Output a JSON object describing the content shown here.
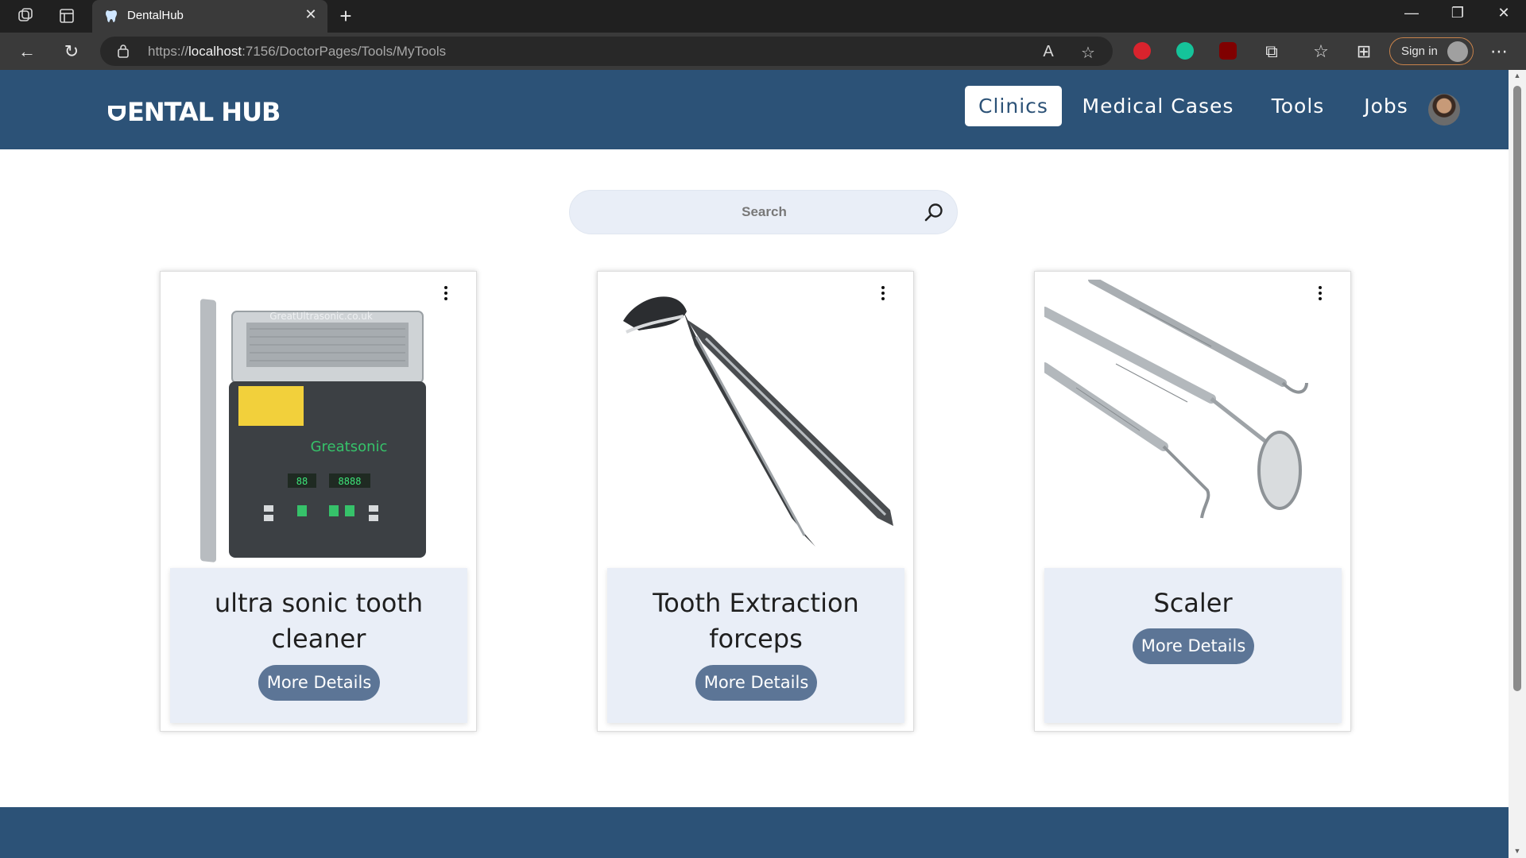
{
  "browser": {
    "tab_title": "DentalHub",
    "url_prefix": "https://",
    "url_host": "localhost",
    "url_path": ":7156/DoctorPages/Tools/MyTools",
    "signin_label": "Sign in"
  },
  "site": {
    "logo_text": "ENTAL HUB",
    "nav": {
      "clinics": "Clinics",
      "medical_cases": "Medical Cases",
      "tools": "Tools",
      "jobs": "Jobs"
    },
    "search_placeholder": "Search"
  },
  "tools": [
    {
      "title": "ultra sonic tooth cleaner",
      "button": "More Details",
      "image": "ultrasonic-cleaner"
    },
    {
      "title": "Tooth Extraction forceps",
      "button": "More Details",
      "image": "extraction-forceps"
    },
    {
      "title": "Scaler",
      "button": "More Details",
      "image": "dental-scaler-set"
    }
  ],
  "colors": {
    "header": "#2c5277",
    "card_body": "#e9eef7",
    "button": "#5c7596"
  }
}
